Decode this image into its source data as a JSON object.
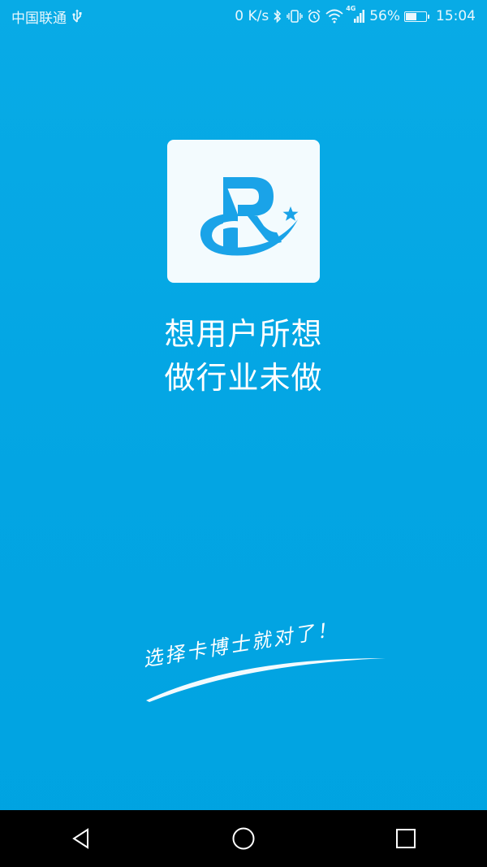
{
  "status_bar": {
    "carrier": "中国联通",
    "net_speed": "0 K/s",
    "network_type": "4G",
    "battery_percent": "56%",
    "battery_level": 0.56,
    "time": "15:04",
    "icons": [
      "usb-icon",
      "bluetooth-icon",
      "vibrate-icon",
      "alarm-icon",
      "wifi-icon",
      "signal-icon",
      "battery-icon"
    ]
  },
  "splash": {
    "logo_icon": "brand-r-logo-icon",
    "slogan_line1": "想用户所想",
    "slogan_line2": "做行业未做",
    "tagline": "选择卡博士就对了！"
  },
  "colors": {
    "background": "#05a8e5",
    "logo_blue": "#1aa3e8",
    "card": "#f3fbfe",
    "nav_bar": "#000000"
  },
  "nav_bar": {
    "icons": [
      "back-triangle-icon",
      "home-circle-icon",
      "recents-square-icon"
    ]
  }
}
